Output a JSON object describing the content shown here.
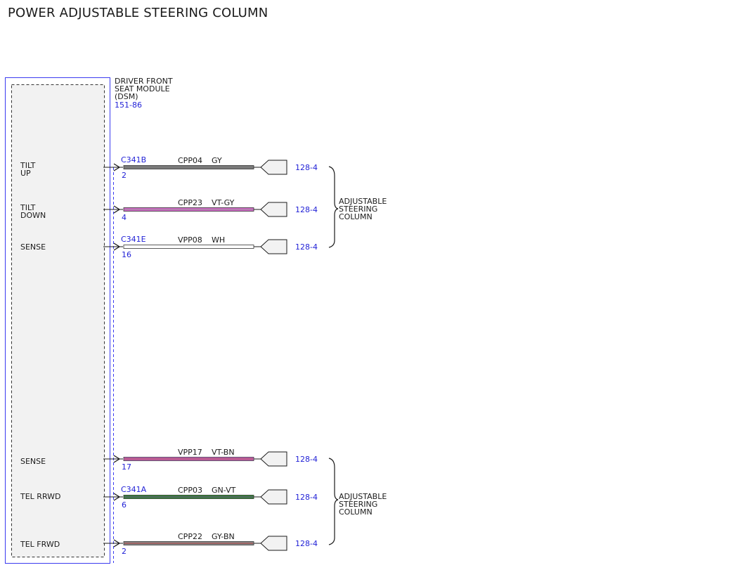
{
  "title": "POWER ADJUSTABLE STEERING COLUMN",
  "module": {
    "name_lines": [
      "DRIVER FRONT",
      "SEAT MODULE",
      "(DSM)"
    ],
    "ref": "151-86"
  },
  "wires": [
    {
      "pin_label": [
        "TILT",
        "UP"
      ],
      "connector": "C341B",
      "pin": "2",
      "circuit": "CPP04",
      "color": "GY",
      "ref": "128-4",
      "stripe_main": "#7a7a7a",
      "stripe_trace": "#7a7a7a"
    },
    {
      "pin_label": [
        "TILT",
        "DOWN"
      ],
      "connector": "",
      "pin": "4",
      "circuit": "CPP23",
      "color": "VT-GY",
      "ref": "128-4",
      "stripe_main": "#d264c8",
      "stripe_trace": "#9a9a9a"
    },
    {
      "pin_label": [
        "SENSE"
      ],
      "connector": "C341E",
      "pin": "16",
      "circuit": "VPP08",
      "color": "WH",
      "ref": "128-4",
      "stripe_main": "#ffffff",
      "stripe_trace": "#ffffff"
    },
    {
      "pin_label": [
        "SENSE"
      ],
      "connector": "",
      "pin": "17",
      "circuit": "VPP17",
      "color": "VT-BN",
      "ref": "128-4",
      "stripe_main": "#d264c8",
      "stripe_trace": "#8b4a2a"
    },
    {
      "pin_label": [
        "TEL RRWD"
      ],
      "connector": "C341A",
      "pin": "6",
      "circuit": "CPP03",
      "color": "GN-VT",
      "ref": "128-4",
      "stripe_main": "#2e8b2e",
      "stripe_trace": "#7a3a9a"
    },
    {
      "pin_label": [
        "TEL FRWD"
      ],
      "connector": "",
      "pin": "2",
      "circuit": "CPP22",
      "color": "GY-BN",
      "ref": "128-4",
      "stripe_main": "#8a8a8a",
      "stripe_trace": "#b03a3a"
    }
  ],
  "groups": [
    {
      "label_lines": [
        "ADJUSTABLE",
        "STEERING",
        "COLUMN"
      ]
    },
    {
      "label_lines": [
        "ADJUSTABLE",
        "STEERING",
        "COLUMN"
      ]
    }
  ]
}
